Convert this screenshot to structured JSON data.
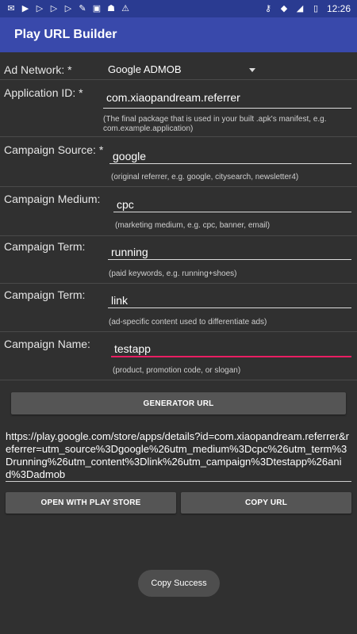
{
  "status": {
    "time": "12:26",
    "left_icons": [
      "mail-icon",
      "play-store-icon",
      "play-icon",
      "play-icon",
      "play-icon",
      "brush-icon",
      "sim-icon",
      "android-icon",
      "alert-icon"
    ],
    "right_icons": [
      "key-icon",
      "wifi-icon",
      "signal-icon",
      "battery-icon"
    ]
  },
  "app": {
    "title": "Play URL Builder"
  },
  "form": {
    "ad_network": {
      "label": "Ad Network: *",
      "value": "Google ADMOB"
    },
    "application_id": {
      "label": "Application ID: *",
      "value": "com.xiaopandream.referrer",
      "hint_line1": "(The final package that is used in your built .apk's manifest, e.g.",
      "hint_line2": "com.example.application)"
    },
    "campaign_source": {
      "label": "Campaign Source: *",
      "value": "google",
      "hint": "(original referrer, e.g. google, citysearch, newsletter4)"
    },
    "campaign_medium": {
      "label": "Campaign Medium:",
      "value": "cpc",
      "hint": "(marketing medium, e.g. cpc, banner, email)"
    },
    "campaign_term": {
      "label": "Campaign Term:",
      "value": "running",
      "hint": "(paid keywords, e.g. running+shoes)"
    },
    "campaign_content": {
      "label": "Campaign Term:",
      "value": "link",
      "hint": "(ad-specific content used to differentiate ads)"
    },
    "campaign_name": {
      "label": "Campaign Name:",
      "value": "testapp",
      "hint": "(product, promotion code, or slogan)"
    }
  },
  "buttons": {
    "generate": "GENERATOR URL",
    "open_play_store": "OPEN WITH PLAY STORE",
    "copy_url": "COPY URL"
  },
  "result_url": "https://play.google.com/store/apps/details?id=com.xiaopandream.referrer&referrer=utm_source%3Dgoogle%26utm_medium%3Dcpc%26utm_term%3Drunning%26utm_content%3Dlink%26utm_campaign%3Dtestapp%26anid%3Dadmob",
  "toast": "Copy Success",
  "colors": {
    "status_bar": "#2a3b91",
    "app_bar": "#3949ab",
    "background": "#303030",
    "accent": "#e91e63",
    "button": "#555555"
  }
}
